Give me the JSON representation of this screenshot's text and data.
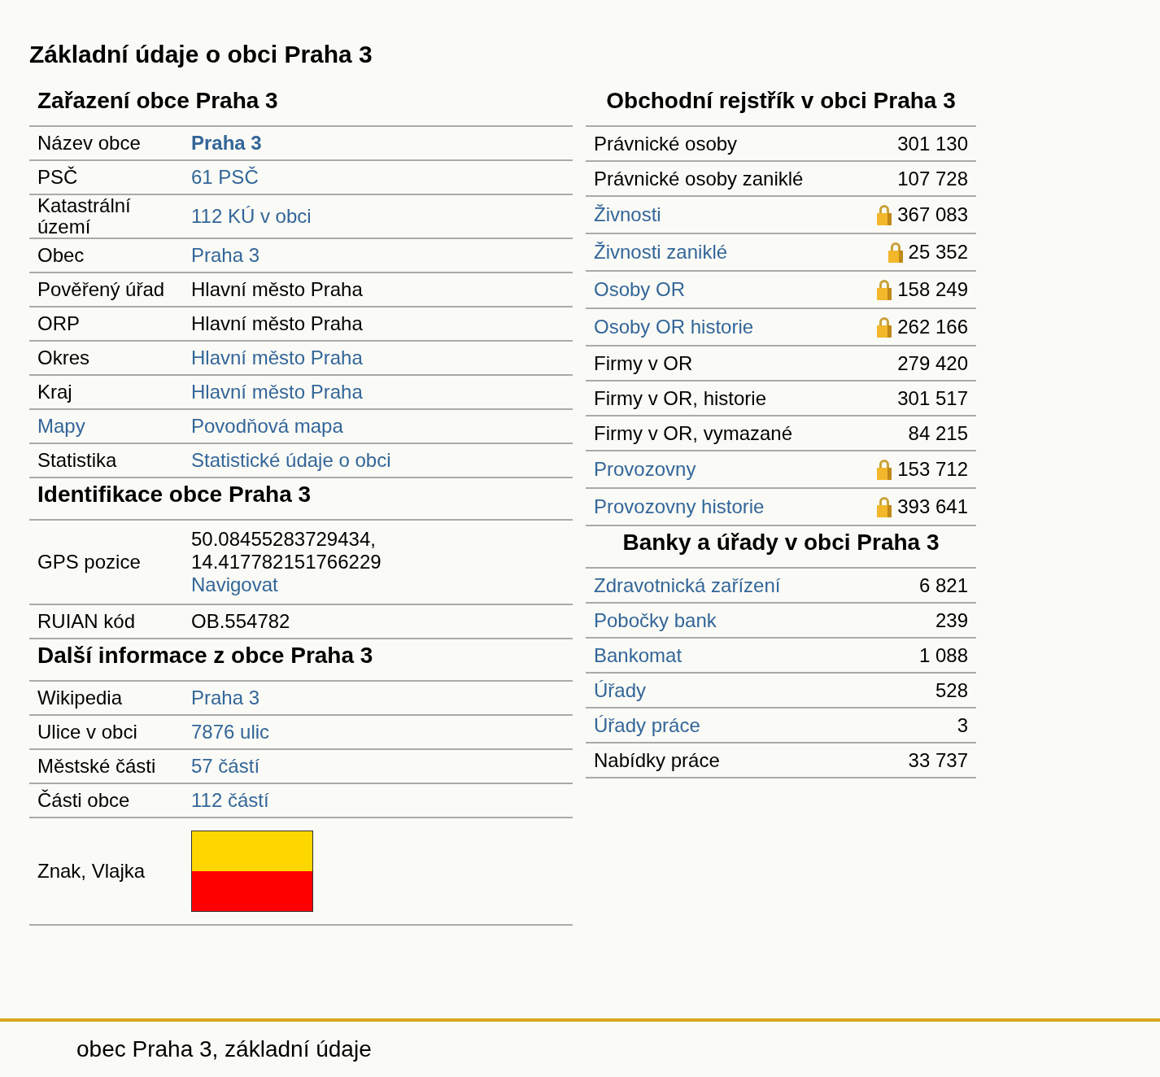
{
  "title": "Základní údaje o obci Praha 3",
  "left_sections": [
    {
      "heading": "Zařazení obce Praha 3",
      "rows": [
        {
          "kind": "text",
          "label": "Název obce",
          "label_link": false,
          "lines": [
            {
              "text": "Praha 3",
              "link": true,
              "bold": true
            }
          ]
        },
        {
          "kind": "text",
          "label": "PSČ",
          "label_link": false,
          "lines": [
            {
              "text": "61 PSČ",
              "link": true
            }
          ]
        },
        {
          "kind": "text",
          "label": "Katastrální území",
          "label_link": false,
          "lines": [
            {
              "text": "112 KÚ v obci",
              "link": true
            }
          ]
        },
        {
          "kind": "text",
          "label": "Obec",
          "label_link": false,
          "lines": [
            {
              "text": "Praha 3",
              "link": true
            }
          ]
        },
        {
          "kind": "text",
          "label": "Pověřený úřad",
          "label_link": false,
          "lines": [
            {
              "text": "Hlavní město Praha",
              "link": false
            }
          ]
        },
        {
          "kind": "text",
          "label": "ORP",
          "label_link": false,
          "lines": [
            {
              "text": "Hlavní město Praha",
              "link": false
            }
          ]
        },
        {
          "kind": "text",
          "label": "Okres",
          "label_link": false,
          "lines": [
            {
              "text": "Hlavní město Praha",
              "link": true
            }
          ]
        },
        {
          "kind": "text",
          "label": "Kraj",
          "label_link": false,
          "lines": [
            {
              "text": "Hlavní město Praha",
              "link": true
            }
          ]
        },
        {
          "kind": "text",
          "label": "Mapy",
          "label_link": true,
          "lines": [
            {
              "text": "Povodňová mapa",
              "link": true
            }
          ]
        },
        {
          "kind": "text",
          "label": "Statistika",
          "label_link": false,
          "lines": [
            {
              "text": "Statistické údaje o obci",
              "link": true
            }
          ]
        }
      ]
    },
    {
      "heading": "Identifikace obce Praha 3",
      "rows": [
        {
          "kind": "text",
          "label": "GPS pozice",
          "label_link": false,
          "lines": [
            {
              "text": "50.08455283729434,",
              "link": false
            },
            {
              "text": "14.417782151766229",
              "link": false
            },
            {
              "text": "Navigovat",
              "link": true
            }
          ]
        },
        {
          "kind": "text",
          "label": "RUIAN kód",
          "label_link": false,
          "lines": [
            {
              "text": "OB.554782",
              "link": false
            }
          ]
        }
      ]
    },
    {
      "heading": "Další informace z obce Praha 3",
      "rows": [
        {
          "kind": "text",
          "label": "Wikipedia",
          "label_link": false,
          "lines": [
            {
              "text": "Praha 3",
              "link": true
            }
          ]
        },
        {
          "kind": "text",
          "label": "Ulice v obci",
          "label_link": false,
          "lines": [
            {
              "text": "7876 ulic",
              "link": true
            }
          ]
        },
        {
          "kind": "text",
          "label": "Městské části",
          "label_link": false,
          "lines": [
            {
              "text": "57 částí",
              "link": true
            }
          ]
        },
        {
          "kind": "text",
          "label": "Části obce",
          "label_link": false,
          "lines": [
            {
              "text": "112 částí",
              "link": true
            }
          ]
        },
        {
          "kind": "flag",
          "label": "Znak, Vlajka",
          "label_link": false
        }
      ]
    }
  ],
  "right_sections": [
    {
      "heading": "Obchodní rejstřík v obci Praha 3",
      "rows": [
        {
          "label": "Právnické osoby",
          "link": false,
          "locked": false,
          "count": "301 130"
        },
        {
          "label": "Právnické osoby zaniklé",
          "link": false,
          "locked": false,
          "count": "107 728"
        },
        {
          "label": "Živnosti",
          "link": true,
          "locked": true,
          "count": "367 083"
        },
        {
          "label": "Živnosti zaniklé",
          "link": true,
          "locked": true,
          "count": "25 352"
        },
        {
          "label": "Osoby OR",
          "link": true,
          "locked": true,
          "count": "158 249"
        },
        {
          "label": "Osoby OR historie",
          "link": true,
          "locked": true,
          "count": "262 166"
        },
        {
          "label": "Firmy v OR",
          "link": false,
          "locked": false,
          "count": "279 420"
        },
        {
          "label": "Firmy v OR, historie",
          "link": false,
          "locked": false,
          "count": "301 517"
        },
        {
          "label": "Firmy v OR, vymazané",
          "link": false,
          "locked": false,
          "count": "84 215"
        },
        {
          "label": "Provozovny",
          "link": true,
          "locked": true,
          "count": "153 712"
        },
        {
          "label": "Provozovny historie",
          "link": true,
          "locked": true,
          "count": "393 641"
        }
      ]
    },
    {
      "heading": "Banky a úřady v obci Praha 3",
      "rows": [
        {
          "label": "Zdravotnická zařízení",
          "link": true,
          "locked": false,
          "count": "6 821"
        },
        {
          "label": "Pobočky bank",
          "link": true,
          "locked": false,
          "count": "239"
        },
        {
          "label": "Bankomat",
          "link": true,
          "locked": false,
          "count": "1 088"
        },
        {
          "label": "Úřady",
          "link": true,
          "locked": false,
          "count": "528"
        },
        {
          "label": "Úřady práce",
          "link": true,
          "locked": false,
          "count": "3"
        },
        {
          "label": "Nabídky práce",
          "link": false,
          "locked": false,
          "count": "33 737"
        }
      ]
    }
  ],
  "footer": "obec Praha 3, základní údaje"
}
